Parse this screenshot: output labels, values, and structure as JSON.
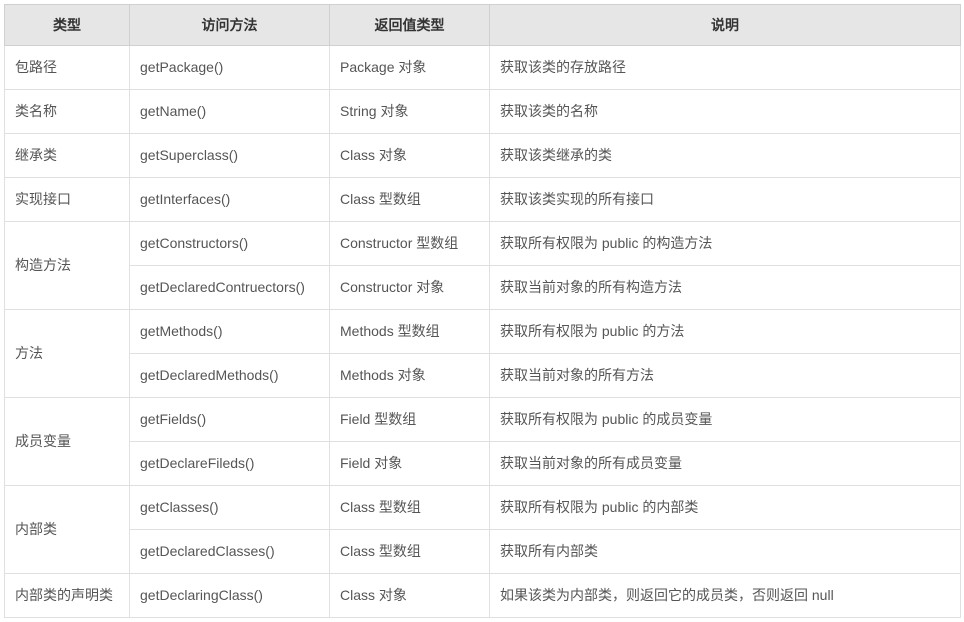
{
  "headers": {
    "type": "类型",
    "method": "访问方法",
    "return": "返回值类型",
    "desc": "说明"
  },
  "groups": [
    {
      "type": "包路径",
      "rows": [
        {
          "method": "getPackage()",
          "return": "Package 对象",
          "desc": "获取该类的存放路径"
        }
      ]
    },
    {
      "type": "类名称",
      "rows": [
        {
          "method": "getName()",
          "return": "String 对象",
          "desc": "获取该类的名称"
        }
      ]
    },
    {
      "type": "继承类",
      "rows": [
        {
          "method": "getSuperclass()",
          "return": "Class 对象",
          "desc": "获取该类继承的类"
        }
      ]
    },
    {
      "type": "实现接口",
      "rows": [
        {
          "method": "getInterfaces()",
          "return": "Class 型数组",
          "desc": "获取该类实现的所有接口"
        }
      ]
    },
    {
      "type": "构造方法",
      "rows": [
        {
          "method": "getConstructors()",
          "return": "Constructor 型数组",
          "desc": "获取所有权限为 public 的构造方法"
        },
        {
          "method": "getDeclaredContruectors()",
          "return": "Constructor 对象",
          "desc": "获取当前对象的所有构造方法"
        }
      ]
    },
    {
      "type": "方法",
      "rows": [
        {
          "method": "getMethods()",
          "return": "Methods 型数组",
          "desc": "获取所有权限为 public 的方法"
        },
        {
          "method": "getDeclaredMethods()",
          "return": "Methods 对象",
          "desc": "获取当前对象的所有方法"
        }
      ]
    },
    {
      "type": "成员变量",
      "rows": [
        {
          "method": "getFields()",
          "return": "Field 型数组",
          "desc": "获取所有权限为 public 的成员变量"
        },
        {
          "method": "getDeclareFileds()",
          "return": "Field 对象",
          "desc": "获取当前对象的所有成员变量"
        }
      ]
    },
    {
      "type": "内部类",
      "rows": [
        {
          "method": "getClasses()",
          "return": "Class 型数组",
          "desc": "获取所有权限为 public 的内部类"
        },
        {
          "method": "getDeclaredClasses()",
          "return": "Class 型数组",
          "desc": "获取所有内部类"
        }
      ]
    },
    {
      "type": "内部类的声明类",
      "rows": [
        {
          "method": "getDeclaringClass()",
          "return": "Class 对象",
          "desc": "如果该类为内部类，则返回它的成员类，否则返回 null"
        }
      ]
    }
  ]
}
